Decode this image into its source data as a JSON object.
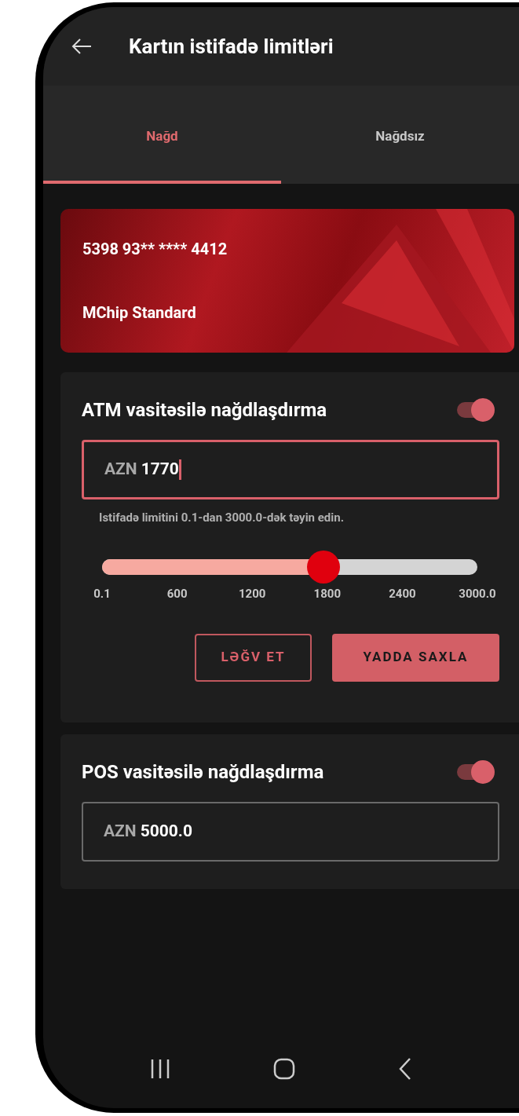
{
  "header": {
    "title": "Kartın istifadə limitləri"
  },
  "tabs": [
    {
      "label": "Nağd",
      "selected": true
    },
    {
      "label": "Nağdsız",
      "selected": false
    }
  ],
  "card": {
    "number": "5398 93** **** 4412",
    "name": "MChip Standard"
  },
  "limits": [
    {
      "kind": "expanded",
      "title": "ATM vasitəsilə nağdlaşdırma",
      "on": true,
      "currency": "AZN",
      "value": "1770",
      "focused": true,
      "hint": "Istifadə limitini 0.1-dan 3000.0-dək təyin edin.",
      "level": 0.59,
      "ticks": [
        "0.1",
        "600",
        "1200",
        "1800",
        "2400",
        "3000.0"
      ],
      "buttons": [
        {
          "label": "LƏĞV ET",
          "kind": "outline"
        },
        {
          "label": "YADDA SAXLA",
          "kind": "filled"
        }
      ]
    },
    {
      "kind": "collapsed",
      "title": "POS vasitəsilə nağdlaşdırma",
      "on": true,
      "currency": "AZN",
      "value": "5000.0",
      "focused": false
    }
  ]
}
